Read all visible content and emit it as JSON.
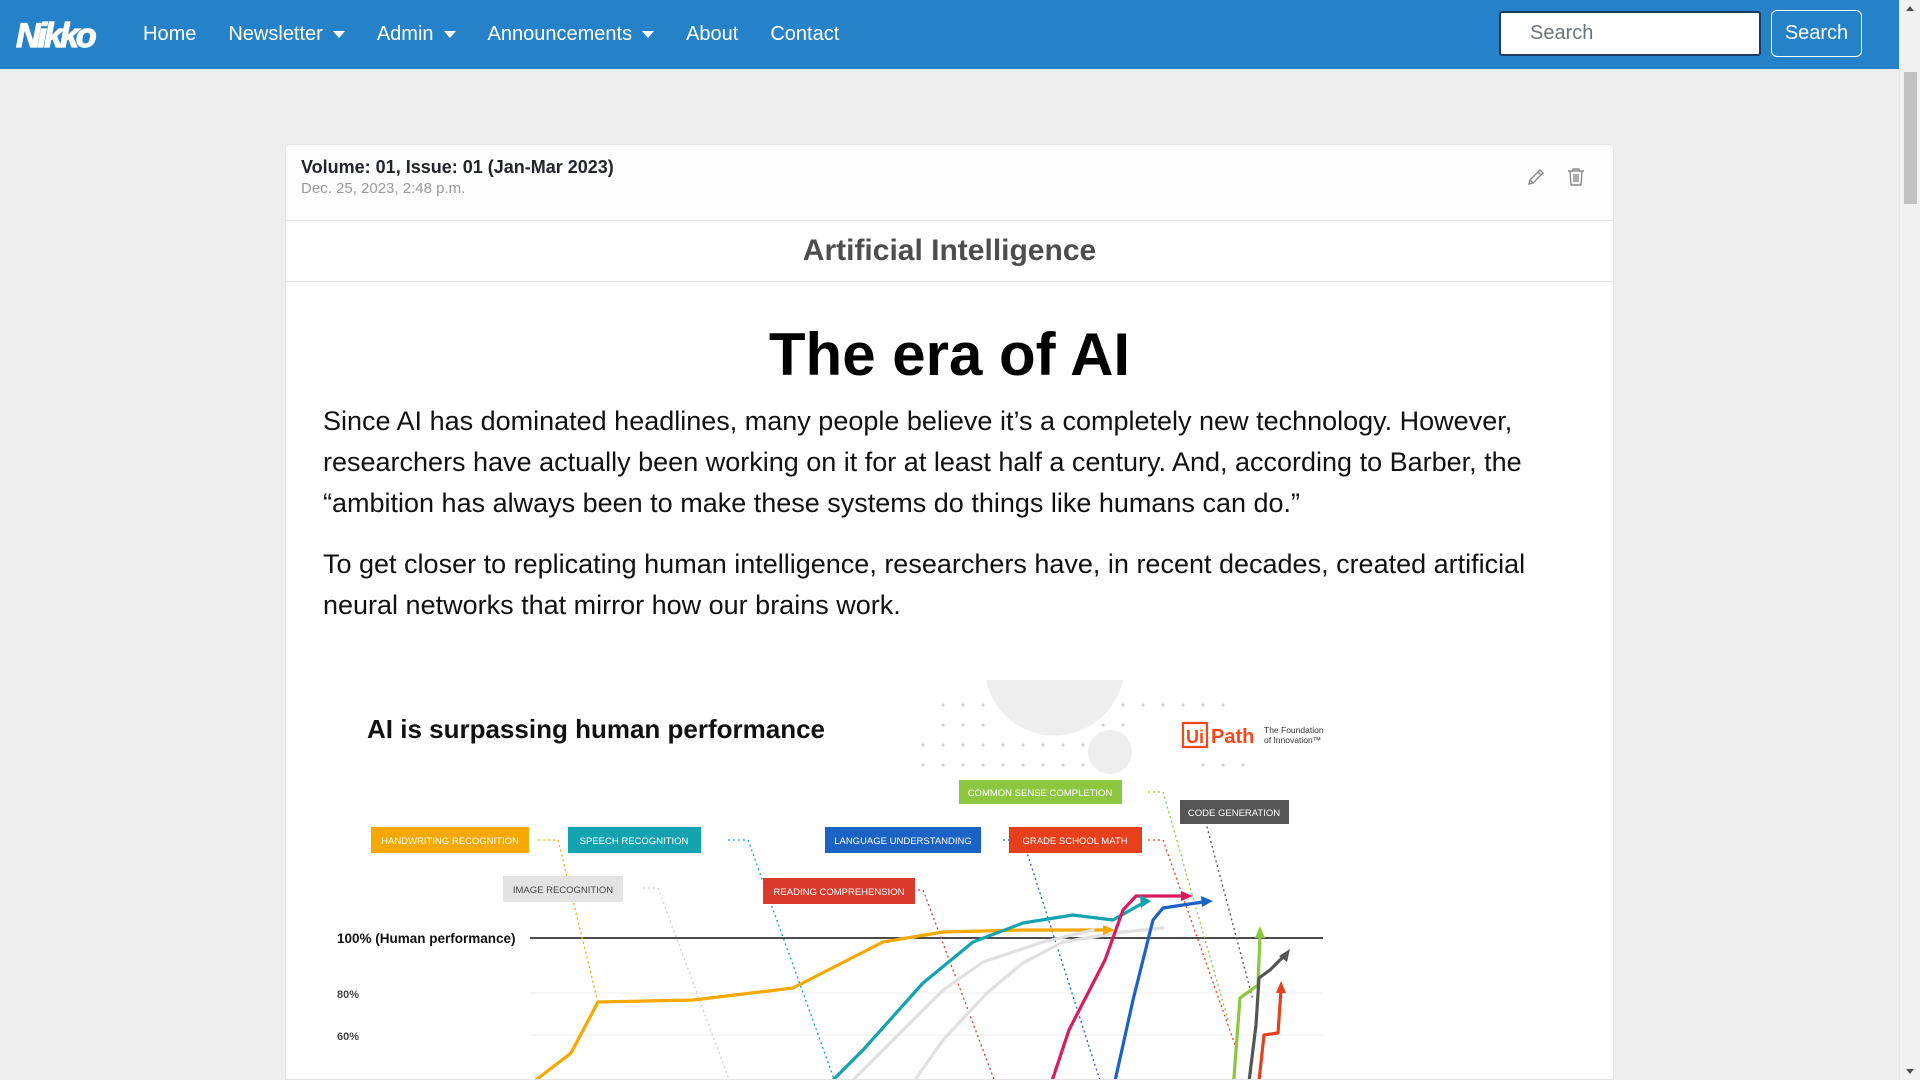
{
  "navbar": {
    "brand": "Nikko",
    "items": [
      {
        "label": "Home",
        "dropdown": false
      },
      {
        "label": "Newsletter",
        "dropdown": true
      },
      {
        "label": "Admin",
        "dropdown": true
      },
      {
        "label": "Announcements",
        "dropdown": true
      },
      {
        "label": "About",
        "dropdown": false
      },
      {
        "label": "Contact",
        "dropdown": false
      }
    ],
    "search_placeholder": "Search",
    "search_button": "Search",
    "colors": {
      "navbar_bg": "#2582c9"
    }
  },
  "post": {
    "issue": "Volume: 01, Issue: 01 (Jan-Mar 2023)",
    "date": "Dec. 25, 2023, 2:48 p.m.",
    "category": "Artificial Intelligence",
    "icons": [
      "pencil-icon",
      "trash-icon"
    ],
    "title": "The era of AI",
    "paragraphs": [
      "Since AI has dominated headlines, many people believe it’s a completely new technology. However, researchers have actually been working on it for at least half a century. And, according to Barber, the “ambition has always been to make these systems do things like humans can do.”",
      "To get closer to replicating human intelligence, researchers have, in recent decades, created artificial neural networks that mirror how our brains work."
    ]
  },
  "infographic": {
    "title": "AI is surpassing human performance",
    "logo": "UiPath",
    "tagline_1": "The Foundation",
    "tagline_2": "of Innovation™",
    "reference_label": "100% (Human performance)",
    "tick_80": "80%",
    "tick_60": "60%",
    "labels": {
      "handwriting": "HANDWRITING RECOGNITION",
      "speech": "SPEECH RECOGNITION",
      "image": "IMAGE RECOGNITION",
      "reading": "READING COMPREHENSION",
      "language": "LANGUAGE UNDERSTANDING",
      "common_sense": "COMMON SENSE COMPLETION",
      "grade_school": "GRADE SCHOOL MATH",
      "code": "CODE GENERATION"
    },
    "colors": {
      "handwriting": "#f5a800",
      "speech": "#13a3b0",
      "image": "#d9d9d9",
      "reading": "#d93a2b",
      "language": "#1a62c4",
      "common_sense": "#8dc63f",
      "grade_school": "#e8401c",
      "code": "#555555",
      "reading_line": "#d81b60"
    }
  }
}
